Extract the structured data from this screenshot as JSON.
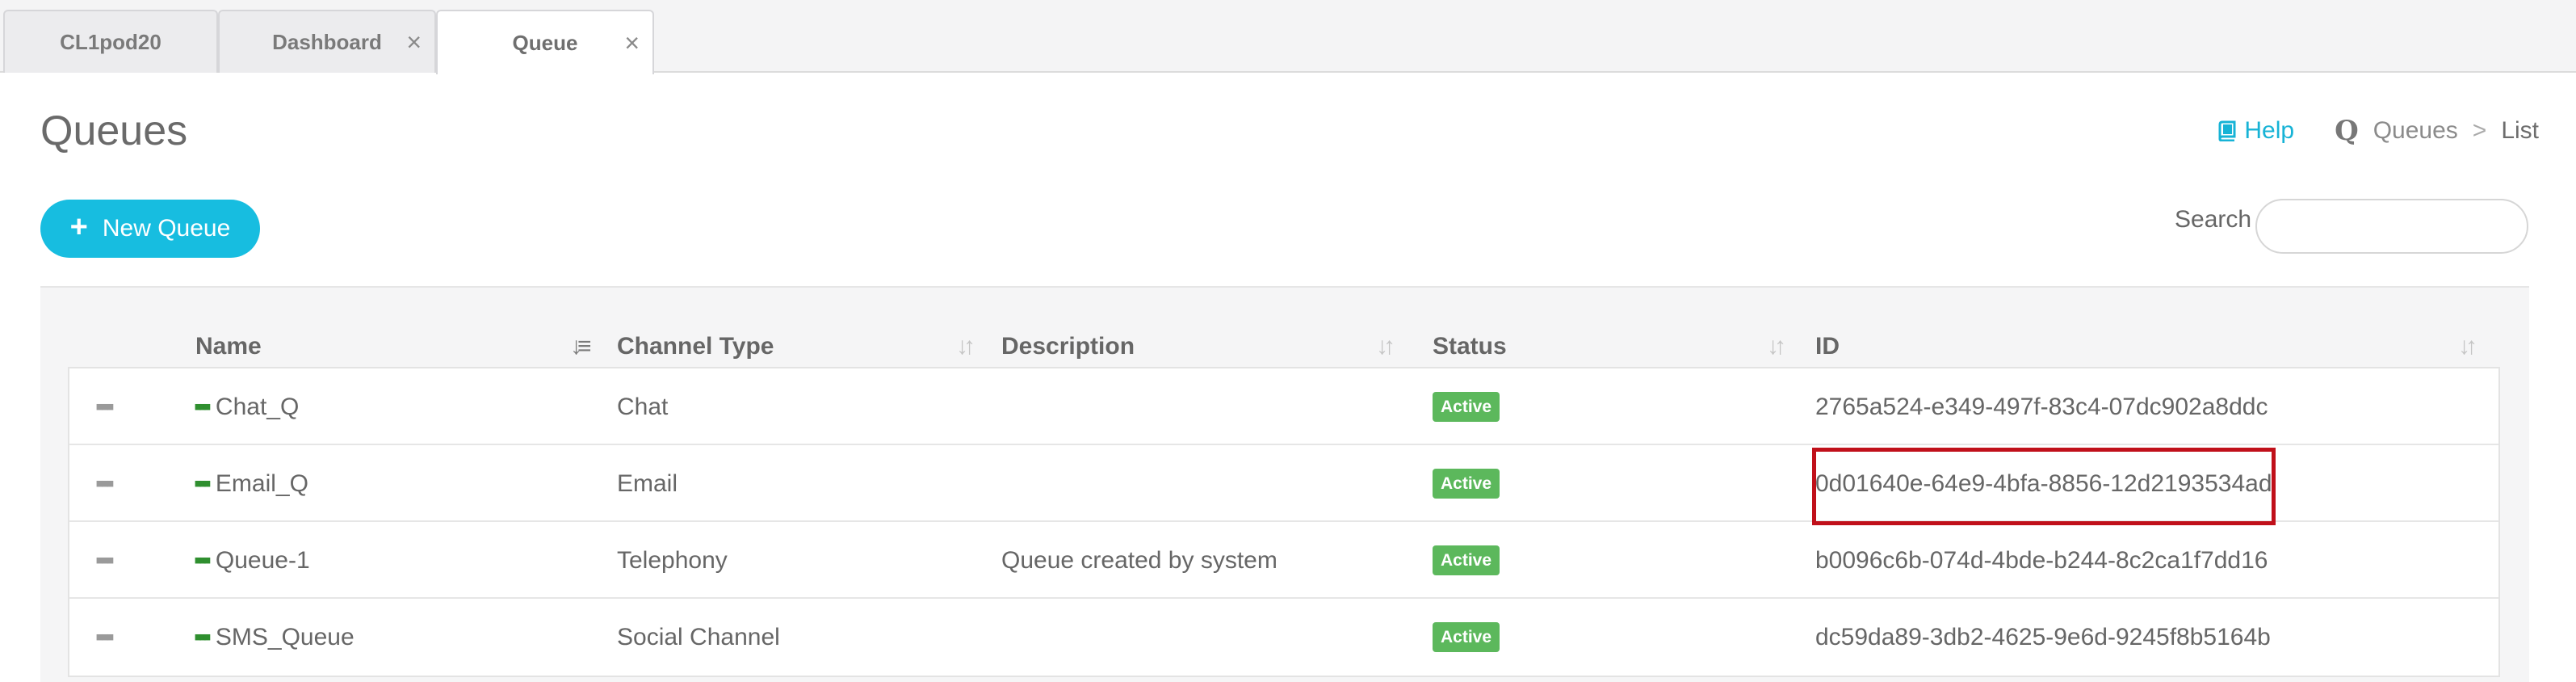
{
  "tabs": [
    {
      "label": "CL1pod20",
      "closable": false
    },
    {
      "label": "Dashboard",
      "closable": true
    },
    {
      "label": "Queue",
      "closable": true,
      "active": true
    }
  ],
  "header": {
    "title": "Queues",
    "help_label": "Help",
    "breadcrumb": [
      "Queues",
      "List"
    ],
    "breadcrumb_separator": ">",
    "queues_icon_glyph": "Q"
  },
  "toolbar": {
    "new_queue_label": "New Queue",
    "search_label": "Search",
    "search_value": "",
    "search_placeholder": ""
  },
  "table": {
    "columns": [
      "Name",
      "Channel Type",
      "Description",
      "Status",
      "ID"
    ],
    "sorted_column": "Name",
    "rows": [
      {
        "name": "Chat_Q",
        "channel_type": "Chat",
        "description": "",
        "status": "Active",
        "id": "2765a524-e349-497f-83c4-07dc902a8ddc"
      },
      {
        "name": "Email_Q",
        "channel_type": "Email",
        "description": "",
        "status": "Active",
        "id": "0d01640e-64e9-4bfa-8856-12d2193534ad",
        "highlighted_id": true
      },
      {
        "name": "Queue-1",
        "channel_type": "Telephony",
        "description": "Queue created by system",
        "status": "Active",
        "id": "b0096c6b-074d-4bde-b244-8c2ca1f7dd16"
      },
      {
        "name": "SMS_Queue",
        "channel_type": "Social Channel",
        "description": "",
        "status": "Active",
        "id": "dc59da89-3db2-4625-9e6d-9245f8b5164b"
      }
    ]
  },
  "colors": {
    "accent": "#17bde0",
    "help_link": "#17b3d6",
    "status_active": "#5cb85c",
    "highlight_box": "#c0101a",
    "queue_dots": "#2f8f2f"
  },
  "icons": {
    "tab_close": "close-icon",
    "help": "book-icon",
    "queues": "queues-icon",
    "new_queue": "plus-icon",
    "row_menu": "more-dots-icon",
    "queue_item": "queue-dots-icon",
    "sort": "sort-icon"
  }
}
